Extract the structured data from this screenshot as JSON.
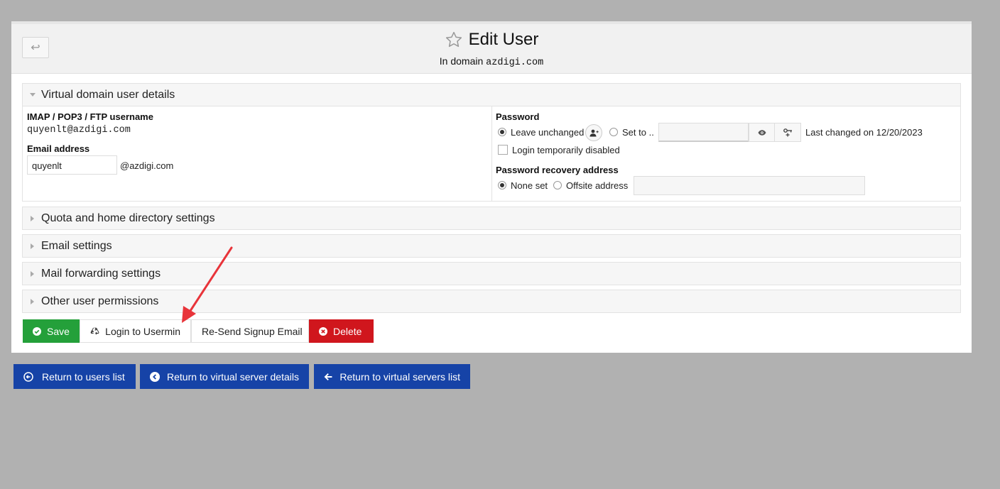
{
  "header": {
    "title": "Edit User",
    "subtitle_prefix": "In domain",
    "domain": "azdigi.com"
  },
  "details_section": {
    "title": "Virtual domain user details",
    "username_label": "IMAP / POP3 / FTP username",
    "username_value": "quyenlt@azdigi.com",
    "email_label": "Email address",
    "email_value": "quyenlt",
    "email_suffix": "@azdigi.com",
    "password_label": "Password",
    "pw_option_unchanged": "Leave unchanged",
    "pw_option_set": "Set to ..",
    "pw_value": "",
    "last_changed": "Last changed on 12/20/2023",
    "login_disabled_label": "Login temporarily disabled",
    "recovery_label": "Password recovery address",
    "recovery_none": "None set",
    "recovery_offsite": "Offsite address",
    "recovery_value": ""
  },
  "collapsed_sections": [
    {
      "title": "Quota and home directory settings"
    },
    {
      "title": "Email settings"
    },
    {
      "title": "Mail forwarding settings"
    },
    {
      "title": "Other user permissions"
    }
  ],
  "actions": {
    "save": "Save",
    "login_usermin": "Login to Usermin",
    "resend": "Re-Send Signup Email",
    "delete": "Delete"
  },
  "nav": {
    "return_users": "Return to users list",
    "return_server_details": "Return to virtual server details",
    "return_servers_list": "Return to virtual servers list"
  },
  "colors": {
    "save": "#24a03a",
    "delete": "#d0161d",
    "nav_blue": "#1643a7",
    "annotation_arrow": "#e8343a"
  }
}
